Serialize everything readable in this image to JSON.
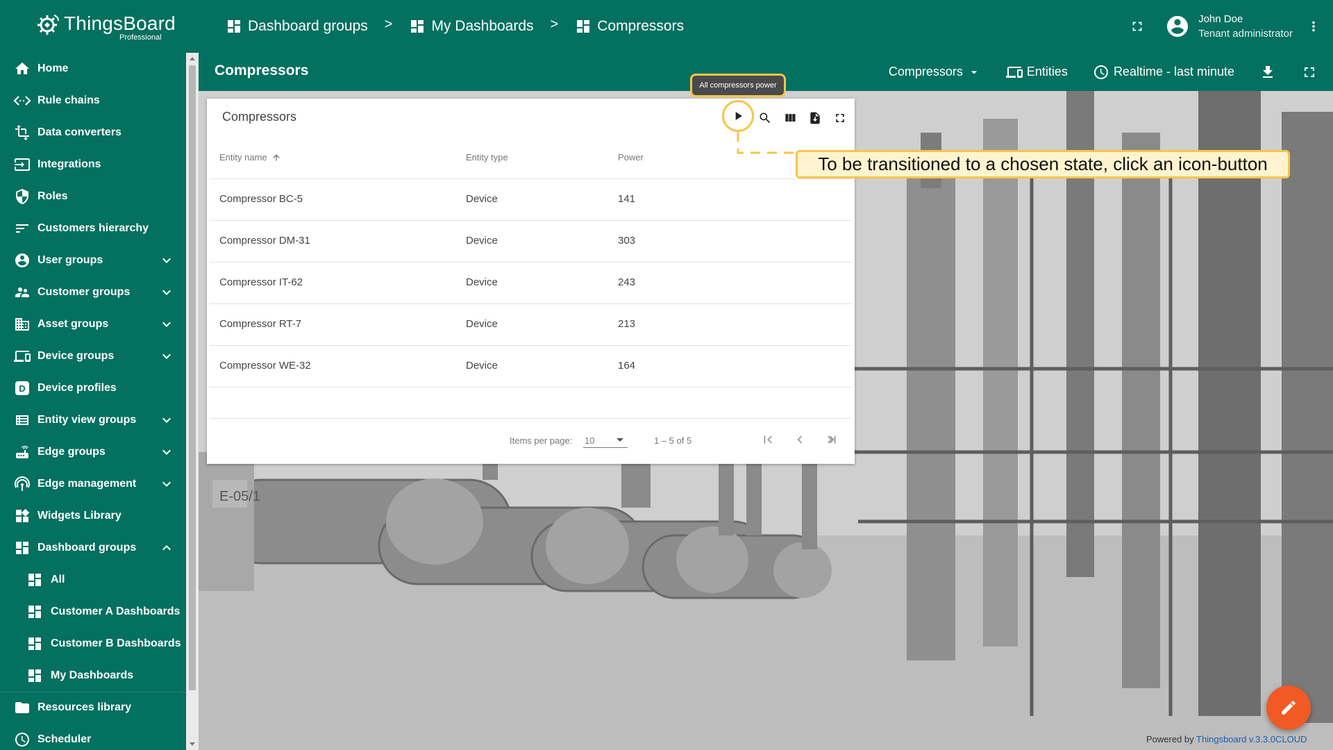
{
  "app": {
    "logo_name": "ThingsBoard",
    "logo_sub": "Professional"
  },
  "breadcrumb": [
    {
      "label": "Dashboard groups"
    },
    {
      "label": "My Dashboards"
    },
    {
      "label": "Compressors"
    }
  ],
  "breadcrumb_sep": ">",
  "user": {
    "name": "John Doe",
    "role": "Tenant administrator"
  },
  "sidebar": {
    "items": [
      {
        "label": "Home",
        "icon": "home-icon"
      },
      {
        "label": "Rule chains",
        "icon": "code-arrows-icon"
      },
      {
        "label": "Data converters",
        "icon": "transform-icon"
      },
      {
        "label": "Integrations",
        "icon": "input-icon"
      },
      {
        "label": "Roles",
        "icon": "shield-icon"
      },
      {
        "label": "Customers hierarchy",
        "icon": "sort-lines-icon"
      },
      {
        "label": "User groups",
        "icon": "account-circle-icon",
        "expandable": true
      },
      {
        "label": "Customer groups",
        "icon": "supervisor-icon",
        "expandable": true
      },
      {
        "label": "Asset groups",
        "icon": "domain-icon",
        "expandable": true
      },
      {
        "label": "Device groups",
        "icon": "devices-icon",
        "expandable": true
      },
      {
        "label": "Device profiles",
        "icon": "device-profile-icon"
      },
      {
        "label": "Entity view groups",
        "icon": "view-quilt-icon",
        "expandable": true
      },
      {
        "label": "Edge groups",
        "icon": "router-icon",
        "expandable": true
      },
      {
        "label": "Edge management",
        "icon": "wifi-tethering-icon",
        "expandable": true
      },
      {
        "label": "Widgets Library",
        "icon": "widgets-icon"
      },
      {
        "label": "Dashboard groups",
        "icon": "dashboard-icon",
        "expanded": true
      },
      {
        "label": "All",
        "icon": "dashboard-icon",
        "sub": true
      },
      {
        "label": "Customer A Dashboards",
        "icon": "dashboard-icon",
        "sub": true
      },
      {
        "label": "Customer B Dashboards",
        "icon": "dashboard-icon",
        "sub": true
      },
      {
        "label": "My Dashboards",
        "icon": "dashboard-icon",
        "sub": true
      },
      {
        "label": "Resources library",
        "icon": "folder-icon"
      },
      {
        "label": "Scheduler",
        "icon": "schedule-icon"
      }
    ]
  },
  "dashboard": {
    "title": "Compressors",
    "state_select": "Compressors",
    "entities_label": "Entities",
    "timewindow_label": "Realtime - last minute"
  },
  "widget": {
    "title": "Compressors",
    "columns": {
      "name": "Entity name",
      "type": "Entity type",
      "power": "Power"
    },
    "rows": [
      {
        "name": "Compressor BC-5",
        "type": "Device",
        "power": "141"
      },
      {
        "name": "Compressor DM-31",
        "type": "Device",
        "power": "303"
      },
      {
        "name": "Compressor IT-62",
        "type": "Device",
        "power": "243"
      },
      {
        "name": "Compressor RT-7",
        "type": "Device",
        "power": "213"
      },
      {
        "name": "Compressor WE-32",
        "type": "Device",
        "power": "164"
      }
    ],
    "pager": {
      "items_per_page_label": "Items per page:",
      "items_per_page_value": "10",
      "range": "1 – 5 of 5"
    }
  },
  "tour": {
    "tooltip_small": "All compressors power",
    "callout": "To be transitioned to a chosen state, click an icon-button"
  },
  "footer": {
    "powered_prefix": "Powered by",
    "powered_link": "Thingsboard v.3.3.0CLOUD"
  },
  "colors": {
    "primary": "#04705f",
    "accent": "#f15a24",
    "highlight": "#f6c54a"
  }
}
